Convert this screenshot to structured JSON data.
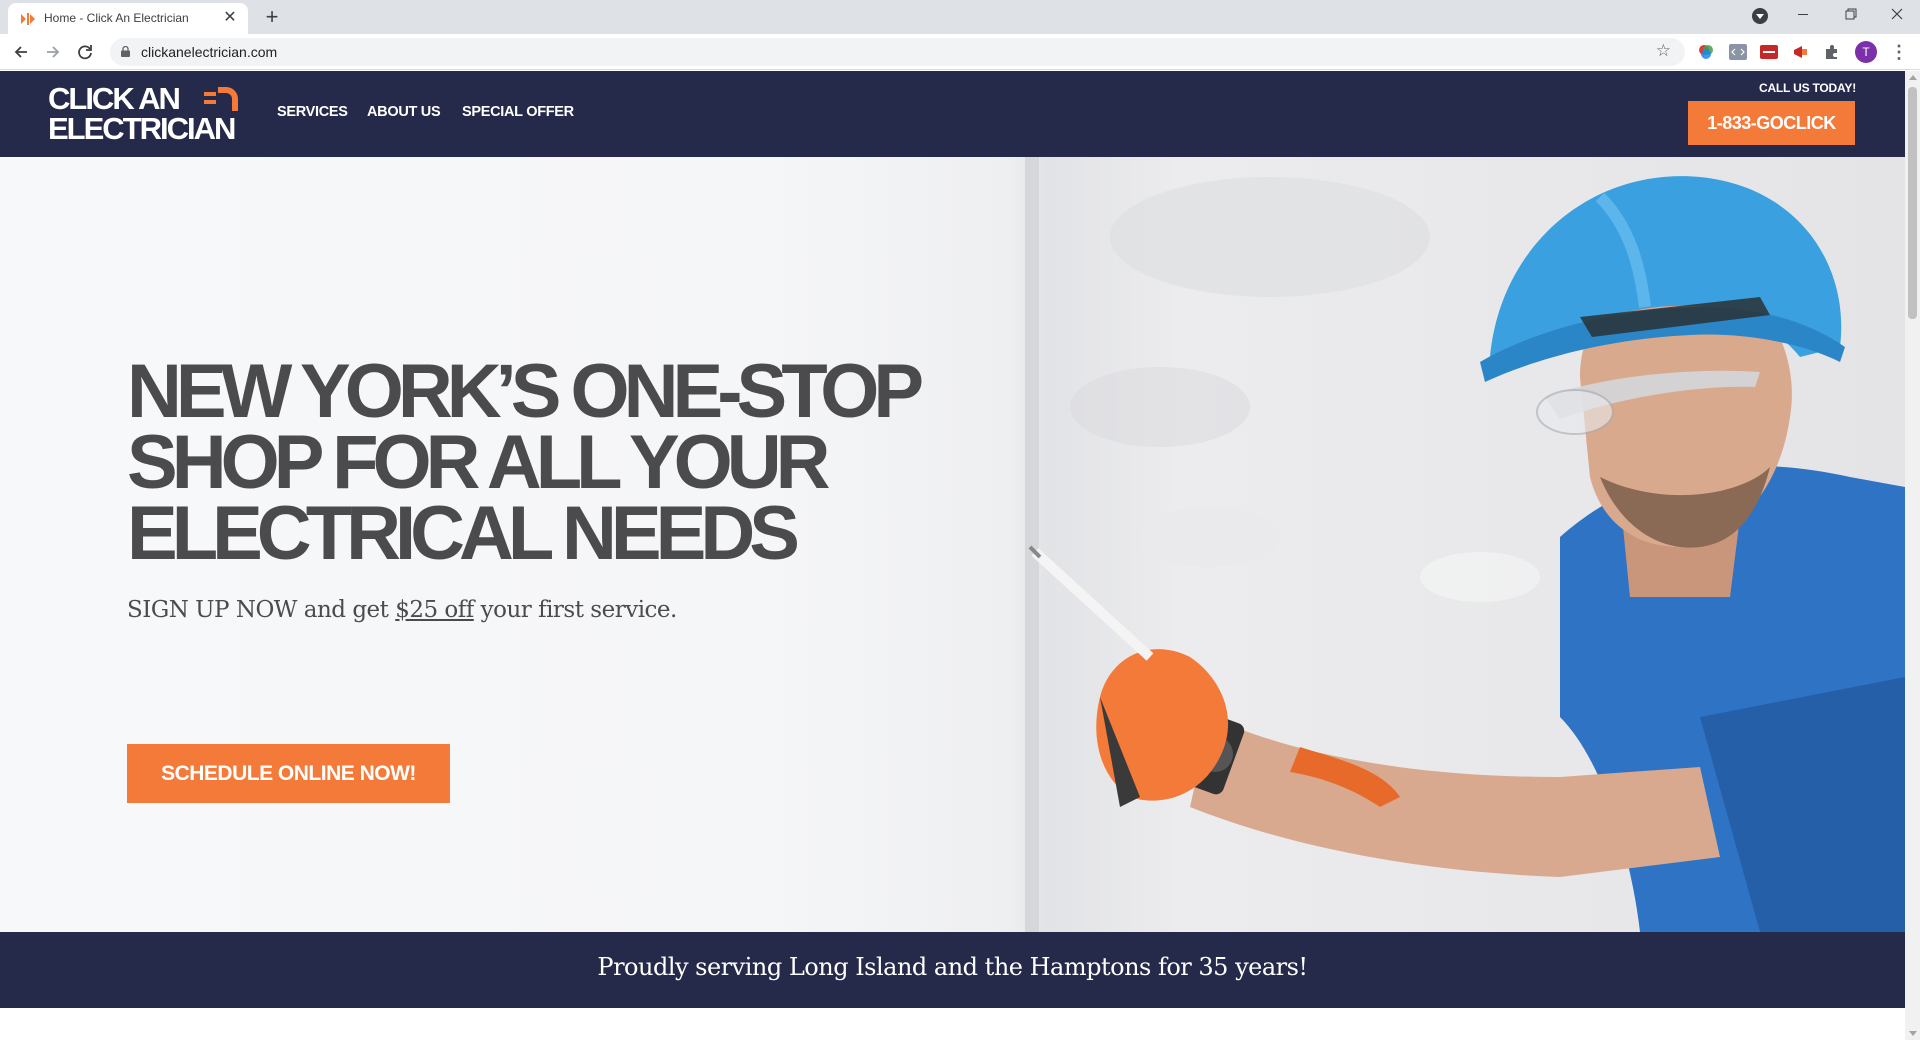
{
  "browser": {
    "tab_title": "Home - Click An Electrician",
    "url": "clickanelectrician.com",
    "profile_initial": "T"
  },
  "header": {
    "logo_line1": "CLICK AN",
    "logo_line2": "ELECTRICIAN",
    "nav": [
      {
        "label": "SERVICES"
      },
      {
        "label": "ABOUT US"
      },
      {
        "label": "SPECIAL OFFER"
      }
    ],
    "call_label": "CALL US TODAY!",
    "phone": "1-833-GOCLICK"
  },
  "hero": {
    "title_lines": [
      "NEW YORK’S ONE-STOP",
      "SHOP FOR ALL YOUR",
      "ELECTRICAL NEEDS"
    ],
    "sub_prefix": "SIGN UP NOW and get ",
    "sub_promo": "$25 off",
    "sub_suffix": " your first service.",
    "cta_label": "SCHEDULE ONLINE NOW!"
  },
  "band": {
    "text": "Proudly serving Long Island and the Hamptons for 35 years!"
  },
  "colors": {
    "navy": "#262a4a",
    "orange": "#f47a3a",
    "heading_gray": "#4b4b4d"
  },
  "icons": [
    "favicon-icon",
    "close-icon",
    "plus-icon",
    "back-arrow-icon",
    "forward-arrow-icon",
    "reload-icon",
    "lock-icon",
    "star-icon",
    "extension-icon",
    "puzzle-icon",
    "kebab-menu-icon"
  ]
}
